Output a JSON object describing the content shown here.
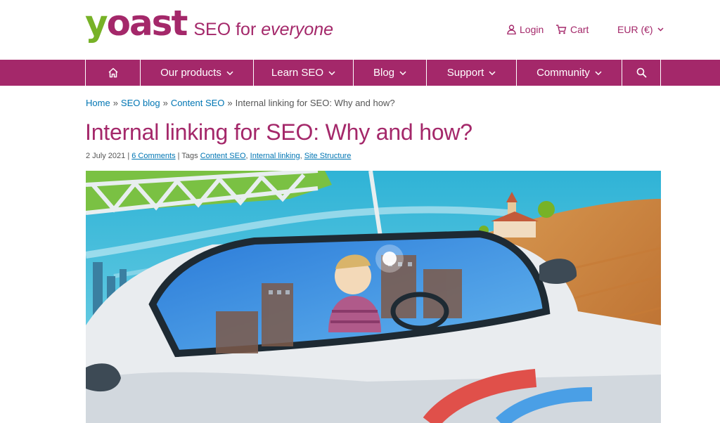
{
  "logo": {
    "brand": "yoast",
    "tagline_prefix": "SEO for ",
    "tagline_emphasis": "everyone"
  },
  "utility": {
    "login": "Login",
    "cart": "Cart",
    "currency": "EUR (€)"
  },
  "nav": {
    "items": [
      {
        "label": "Our products"
      },
      {
        "label": "Learn SEO"
      },
      {
        "label": "Blog"
      },
      {
        "label": "Support"
      },
      {
        "label": "Community"
      }
    ]
  },
  "breadcrumb": {
    "home": "Home",
    "blog": "SEO blog",
    "category": "Content SEO",
    "current": "Internal linking for SEO: Why and how?",
    "sep": "»"
  },
  "article": {
    "title": "Internal linking for SEO: Why and how?",
    "date": "2 July 2021",
    "comments": "6 Comments",
    "tags_label": "| Tags",
    "tags": [
      "Content SEO",
      "Internal linking",
      "Site Structure"
    ]
  },
  "colors": {
    "brand": "#a4286a",
    "logo_green": "#77b227",
    "link": "#0075b3"
  },
  "icons": {
    "home": "home-icon",
    "search": "search-icon",
    "user": "user-icon",
    "cart": "cart-icon"
  }
}
